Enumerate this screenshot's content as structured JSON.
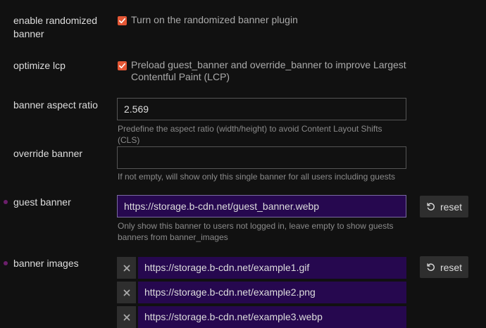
{
  "settings": {
    "enable_randomized_banner": {
      "label": "enable randomized banner",
      "checked": true,
      "checkbox_label": "Turn on the randomized banner plugin"
    },
    "optimize_lcp": {
      "label": "optimize lcp",
      "checked": true,
      "checkbox_label": "Preload guest_banner and override_banner to improve Largest Contentful Paint (LCP)"
    },
    "banner_aspect_ratio": {
      "label": "banner aspect ratio",
      "value": "2.569",
      "description": "Predefine the aspect ratio (width/height) to avoid Content Layout Shifts (CLS)"
    },
    "override_banner": {
      "label": "override banner",
      "value": "",
      "description": "If not empty, will show only this single banner for all users including guests"
    },
    "guest_banner": {
      "label": "guest banner",
      "value": "https://storage.b-cdn.net/guest_banner.webp",
      "description": "Only show this banner to users not logged in, leave empty to show guests banners from banner_images",
      "reset_label": "reset"
    },
    "banner_images": {
      "label": "banner images",
      "items": [
        "https://storage.b-cdn.net/example1.gif",
        "https://storage.b-cdn.net/example2.png",
        "https://storage.b-cdn.net/example3.webp"
      ],
      "reset_label": "reset"
    }
  },
  "colors": {
    "background": "#111111",
    "checkbox": "#e45735",
    "modified_input": "#26084f",
    "overridden_marker": "#6b1f6b"
  },
  "icons": {
    "checkbox_check": "check-icon",
    "reset": "undo-icon",
    "remove": "times-icon"
  }
}
